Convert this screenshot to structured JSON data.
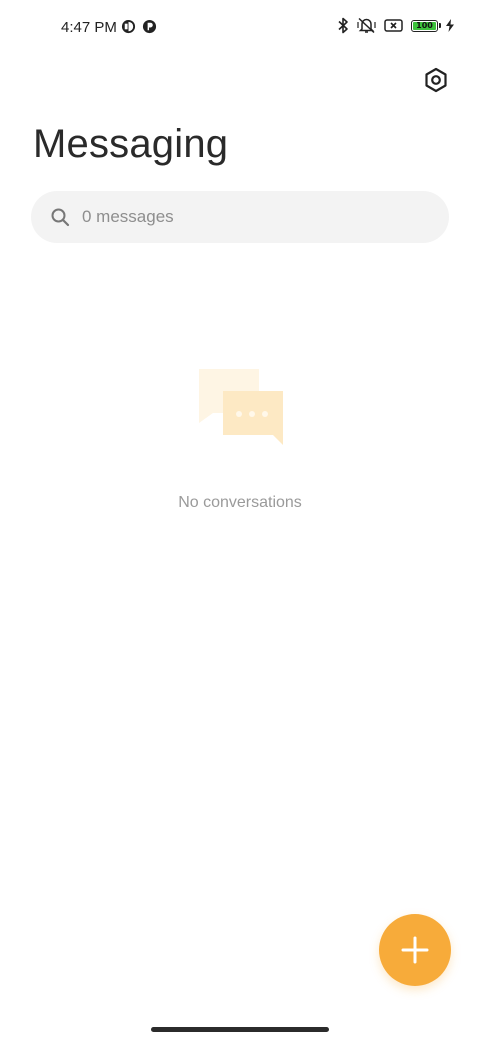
{
  "status_bar": {
    "time": "4:47 PM",
    "battery_level": "100",
    "battery_color": "#3cc13b",
    "icons": [
      "app-notification-icon",
      "app-notification-icon",
      "bluetooth-icon",
      "vibrate-off-icon",
      "no-sim-icon",
      "battery-icon",
      "charging-icon"
    ]
  },
  "header": {
    "title": "Messaging",
    "settings_icon": "settings-icon"
  },
  "search": {
    "placeholder": "0 messages",
    "icon": "search-icon"
  },
  "empty_state": {
    "text": "No conversations",
    "illustration": "chat-bubbles-icon"
  },
  "fab": {
    "icon": "plus-icon",
    "color": "#f7ab3a"
  }
}
